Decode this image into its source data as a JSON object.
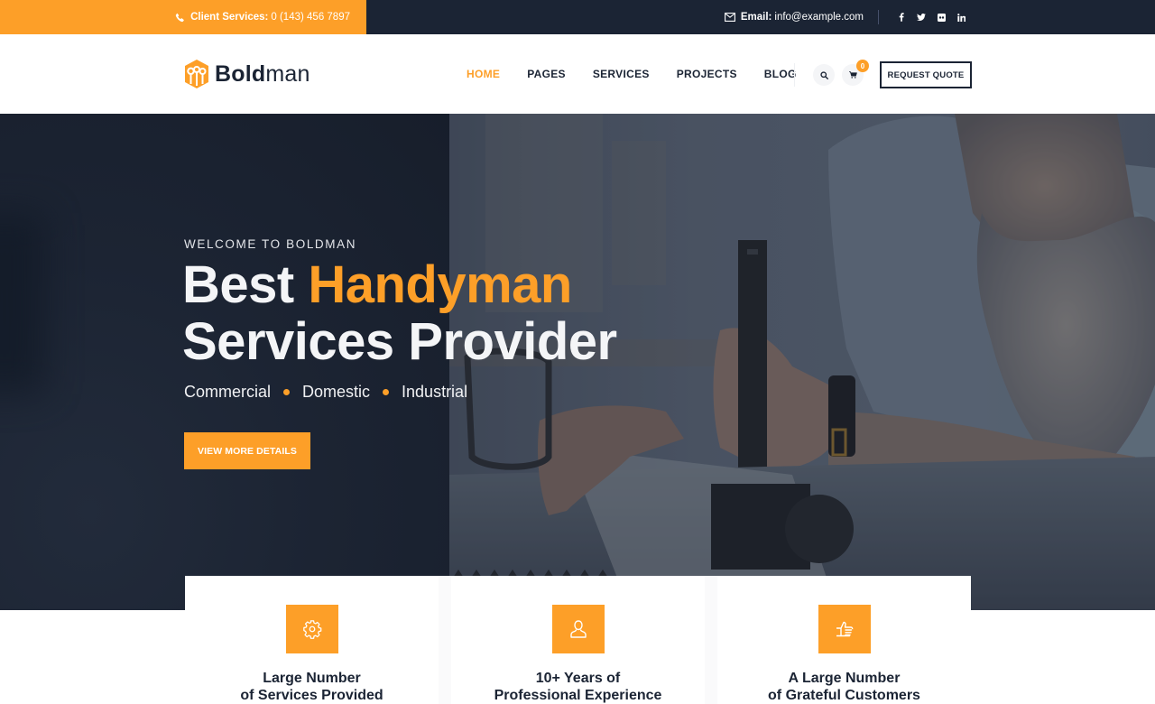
{
  "topbar": {
    "phone_label": "Client Services:",
    "phone_value": "0 (143) 456 7897",
    "email_label": "Email:",
    "email_value": "info@example.com",
    "social": [
      {
        "name": "facebook-icon",
        "glyph": "f"
      },
      {
        "name": "twitter-icon",
        "glyph": "t"
      },
      {
        "name": "flickr-icon",
        "glyph": "fl"
      },
      {
        "name": "linkedin-icon",
        "glyph": "in"
      }
    ]
  },
  "header": {
    "logo_bold": "Bold",
    "logo_light": "man",
    "nav": [
      {
        "label": "HOME",
        "active": true
      },
      {
        "label": "PAGES",
        "active": false
      },
      {
        "label": "SERVICES",
        "active": false
      },
      {
        "label": "PROJECTS",
        "active": false
      },
      {
        "label": "BLOG",
        "active": false
      }
    ],
    "cart_count": "0",
    "quote_label": "REQUEST QUOTE"
  },
  "hero": {
    "eyebrow": "WELCOME TO BOLDMAN",
    "title_line1_a": "Best ",
    "title_line1_b": "Handyman",
    "title_line2": "Services Provider",
    "tags": [
      "Commercial",
      "Domestic",
      "Industrial"
    ],
    "cta_label": "VIEW MORE DETAILS"
  },
  "features": [
    {
      "icon": "gear-icon",
      "line1": "Large Number",
      "line2": "of Services Provided"
    },
    {
      "icon": "user-icon",
      "line1": "10+ Years of",
      "line2": "Professional Experience"
    },
    {
      "icon": "thumbs-up-icon",
      "line1": "A Large Number",
      "line2": "of Grateful Customers"
    }
  ],
  "colors": {
    "accent": "#fd9f28",
    "dark": "#1b2434",
    "white": "#ffffff"
  }
}
